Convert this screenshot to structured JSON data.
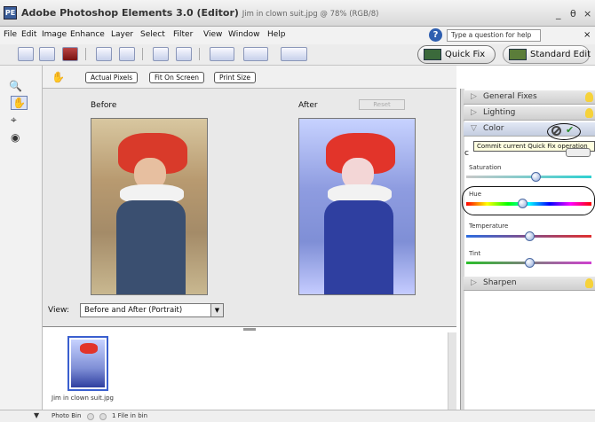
{
  "window": {
    "title_bold": "Adobe Photoshop Elements 3.0 (Editor)",
    "title_doc": "Jim in clown suit.jpg @ 78% (RGB/8)",
    "minimize": "_",
    "restore": "θ",
    "close": "×"
  },
  "menu": [
    "File",
    "Edit",
    "Image",
    "Enhance",
    "Layer",
    "Select",
    "Filter",
    "View",
    "Window",
    "Help"
  ],
  "help": {
    "search_text": "Type a question for help",
    "close": "×"
  },
  "toolbar": {
    "icons": [
      "new-file-icon",
      "open-icon",
      "save-icon",
      "print-icon",
      "print-preview-icon",
      "undo-icon",
      "redo-icon",
      "photo-browser-icon",
      "organizer-icon",
      "create-icon"
    ],
    "quick_fix": "Quick Fix",
    "standard_edit": "Standard Edit"
  },
  "options_bar": {
    "actual_pixels": "Actual Pixels",
    "fit_on_screen": "Fit On Screen",
    "print_size": "Print Size"
  },
  "canvas": {
    "before_label": "Before",
    "after_label": "After",
    "reset": "Reset",
    "view_label": "View:",
    "view_value": "Before and After (Portrait)"
  },
  "panel": {
    "general_fixes": "General Fixes",
    "lighting": "Lighting",
    "color": "Color",
    "sharpen": "Sharpen",
    "tooltip": "Commit current Quick Fix operation",
    "c_letter": "c",
    "sliders": [
      {
        "label": "Saturation",
        "value": 0.55
      },
      {
        "label": "Hue",
        "value": 0.45
      },
      {
        "label": "Temperature",
        "value": 0.5
      },
      {
        "label": "Tint",
        "value": 0.5
      }
    ]
  },
  "photo_bin": {
    "caption": "Jim in clown suit.jpg"
  },
  "status": {
    "photo_bin": "Photo Bin",
    "file_count": "1 File in bin"
  }
}
